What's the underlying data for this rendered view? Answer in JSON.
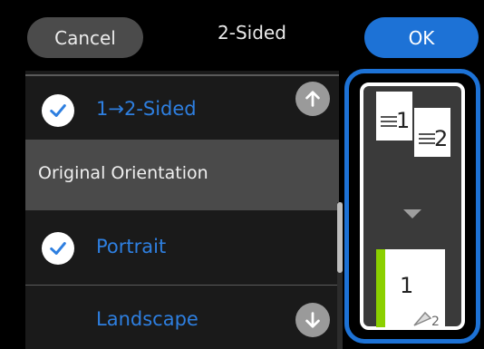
{
  "topbar": {
    "cancel_label": "Cancel",
    "title": "2-Sided",
    "ok_label": "OK"
  },
  "options": {
    "mode": {
      "label": "1→2-Sided",
      "checked": true
    },
    "section_header": "Original Orientation",
    "orientation": [
      {
        "label": "Portrait",
        "checked": true
      },
      {
        "label": "Landscape",
        "checked": false
      }
    ]
  },
  "preview": {
    "front_number": "1",
    "back_number": "2",
    "output_front_number": "1",
    "output_back_number": "2"
  },
  "colors": {
    "accent": "#1d72d6",
    "check_blue": "#2e7fe0",
    "green_strip": "#8bd000"
  }
}
